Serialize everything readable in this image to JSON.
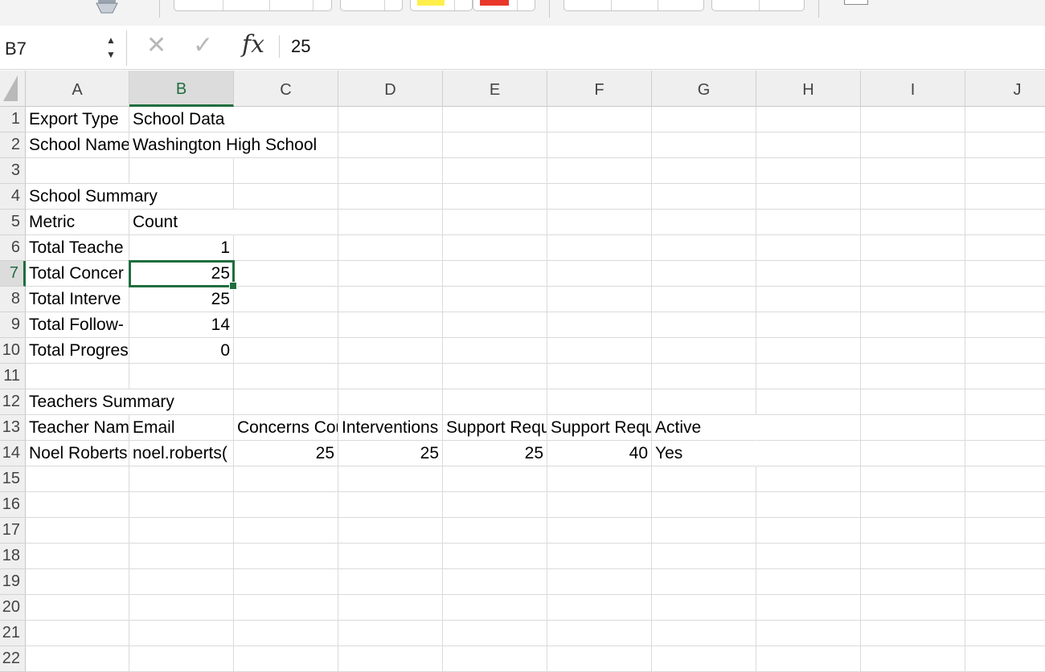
{
  "name_box": "B7",
  "formula_value": "25",
  "formula_icons": {
    "cancel": "✕",
    "enter": "✓",
    "function": "fx"
  },
  "columns": [
    "A",
    "B",
    "C",
    "D",
    "E",
    "F",
    "G",
    "H",
    "I",
    "J"
  ],
  "selected_column": "B",
  "selected_row": "7",
  "rows": [
    {
      "n": "1",
      "cells": [
        "Export Type",
        "School Data",
        "",
        "",
        "",
        "",
        "",
        "",
        "",
        ""
      ]
    },
    {
      "n": "2",
      "cells": [
        "School Name",
        "Washington High School",
        "",
        "",
        "",
        "",
        "",
        "",
        "",
        ""
      ]
    },
    {
      "n": "3",
      "cells": [
        "",
        "",
        "",
        "",
        "",
        "",
        "",
        "",
        "",
        ""
      ]
    },
    {
      "n": "4",
      "cells": [
        "School Summary",
        "",
        "",
        "",
        "",
        "",
        "",
        "",
        "",
        ""
      ]
    },
    {
      "n": "5",
      "cells": [
        "Metric",
        "Count",
        "",
        "",
        "",
        "",
        "",
        "",
        "",
        ""
      ]
    },
    {
      "n": "6",
      "cells": [
        "Total Teache",
        "1",
        "",
        "",
        "",
        "",
        "",
        "",
        "",
        ""
      ]
    },
    {
      "n": "7",
      "cells": [
        "Total Concer",
        "25",
        "",
        "",
        "",
        "",
        "",
        "",
        "",
        ""
      ]
    },
    {
      "n": "8",
      "cells": [
        "Total Interve",
        "25",
        "",
        "",
        "",
        "",
        "",
        "",
        "",
        ""
      ]
    },
    {
      "n": "9",
      "cells": [
        "Total Follow-",
        "14",
        "",
        "",
        "",
        "",
        "",
        "",
        "",
        ""
      ]
    },
    {
      "n": "10",
      "cells": [
        "Total Progres",
        "0",
        "",
        "",
        "",
        "",
        "",
        "",
        "",
        ""
      ]
    },
    {
      "n": "11",
      "cells": [
        "",
        "",
        "",
        "",
        "",
        "",
        "",
        "",
        "",
        ""
      ]
    },
    {
      "n": "12",
      "cells": [
        "Teachers Summary",
        "",
        "",
        "",
        "",
        "",
        "",
        "",
        "",
        ""
      ]
    },
    {
      "n": "13",
      "cells": [
        "Teacher Nam",
        "Email",
        "Concerns Cou",
        "Interventions",
        "Support Requ",
        "Support Requ",
        "Active",
        "",
        "",
        ""
      ]
    },
    {
      "n": "14",
      "cells": [
        "Noel Roberts",
        "noel.roberts(",
        "25",
        "25",
        "25",
        "40",
        "Yes",
        "",
        "",
        ""
      ]
    },
    {
      "n": "15",
      "cells": [
        "",
        "",
        "",
        "",
        "",
        "",
        "",
        "",
        "",
        ""
      ]
    },
    {
      "n": "16",
      "cells": [
        "",
        "",
        "",
        "",
        "",
        "",
        "",
        "",
        "",
        ""
      ]
    },
    {
      "n": "17",
      "cells": [
        "",
        "",
        "",
        "",
        "",
        "",
        "",
        "",
        "",
        ""
      ]
    },
    {
      "n": "18",
      "cells": [
        "",
        "",
        "",
        "",
        "",
        "",
        "",
        "",
        "",
        ""
      ]
    },
    {
      "n": "19",
      "cells": [
        "",
        "",
        "",
        "",
        "",
        "",
        "",
        "",
        "",
        ""
      ]
    },
    {
      "n": "20",
      "cells": [
        "",
        "",
        "",
        "",
        "",
        "",
        "",
        "",
        "",
        ""
      ]
    },
    {
      "n": "21",
      "cells": [
        "",
        "",
        "",
        "",
        "",
        "",
        "",
        "",
        "",
        ""
      ]
    },
    {
      "n": "22",
      "cells": [
        "",
        "",
        "",
        "",
        "",
        "",
        "",
        "",
        "",
        ""
      ]
    }
  ],
  "colors": {
    "selection": "#1f6e3e",
    "fill_yellow": "#ffef4a",
    "fill_red": "#e8372a"
  }
}
